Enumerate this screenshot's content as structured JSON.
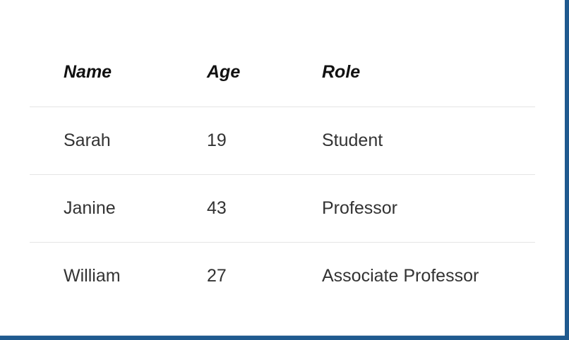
{
  "table": {
    "headers": [
      "Name",
      "Age",
      "Role"
    ],
    "rows": [
      [
        "Sarah",
        "19",
        "Student"
      ],
      [
        "Janine",
        "43",
        "Professor"
      ],
      [
        "William",
        "27",
        "Associate Professor"
      ]
    ]
  },
  "colors": {
    "window_border": "#1f5a8f",
    "background": "#ffffff",
    "row_divider": "#e5e5e5",
    "header_text": "#111111",
    "body_text": "#333333"
  }
}
